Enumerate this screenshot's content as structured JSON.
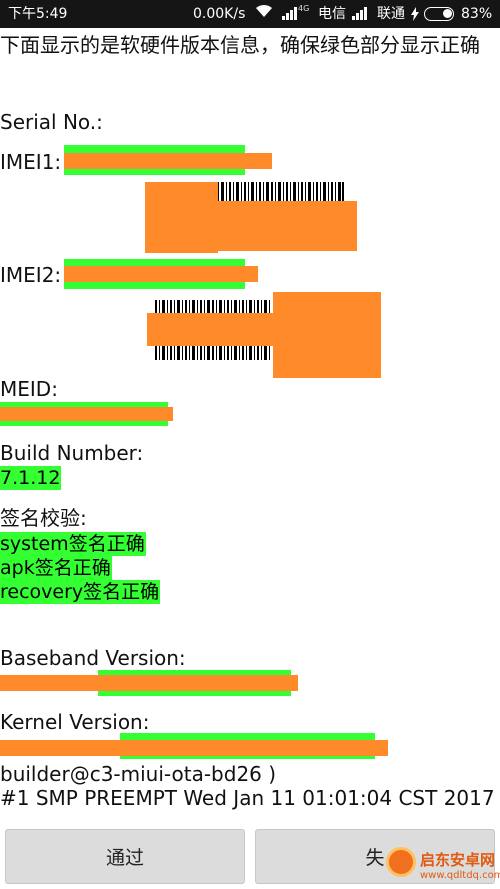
{
  "status_bar": {
    "time": "下午5:49",
    "net_speed": "0.00K/s",
    "sim1_tag": "4G",
    "operator1": "电信",
    "operator2": "联通",
    "battery": "83%"
  },
  "header_text": "下面显示的是软硬件版本信息，确保绿色部分显示正确",
  "serial_label": "Serial No.:",
  "imei1_label": "IMEI1:",
  "imei2_label": "IMEI2:",
  "meid_label": "MEID:",
  "build_label": "Build Number:",
  "build_value": "7.1.12",
  "signature_label": "签名校验:",
  "signature_items": [
    "system签名正确",
    "apk签名正确",
    "recovery签名正确"
  ],
  "baseband_label": "Baseband Version:",
  "kernel_label": "Kernel Version:",
  "kernel_line2": "builder@c3-miui-ota-bd26 )",
  "kernel_line3": "#1 SMP PREEMPT Wed Jan 11 01:01:04 CST 2017",
  "buttons": {
    "pass": "通过",
    "fail": "失"
  },
  "watermark": {
    "name": "启东安卓网",
    "url": "www.qdltdq.com"
  },
  "colors": {
    "highlight": "#33ff33",
    "redaction": "#ff8a2a",
    "status_bar": "#151515"
  }
}
